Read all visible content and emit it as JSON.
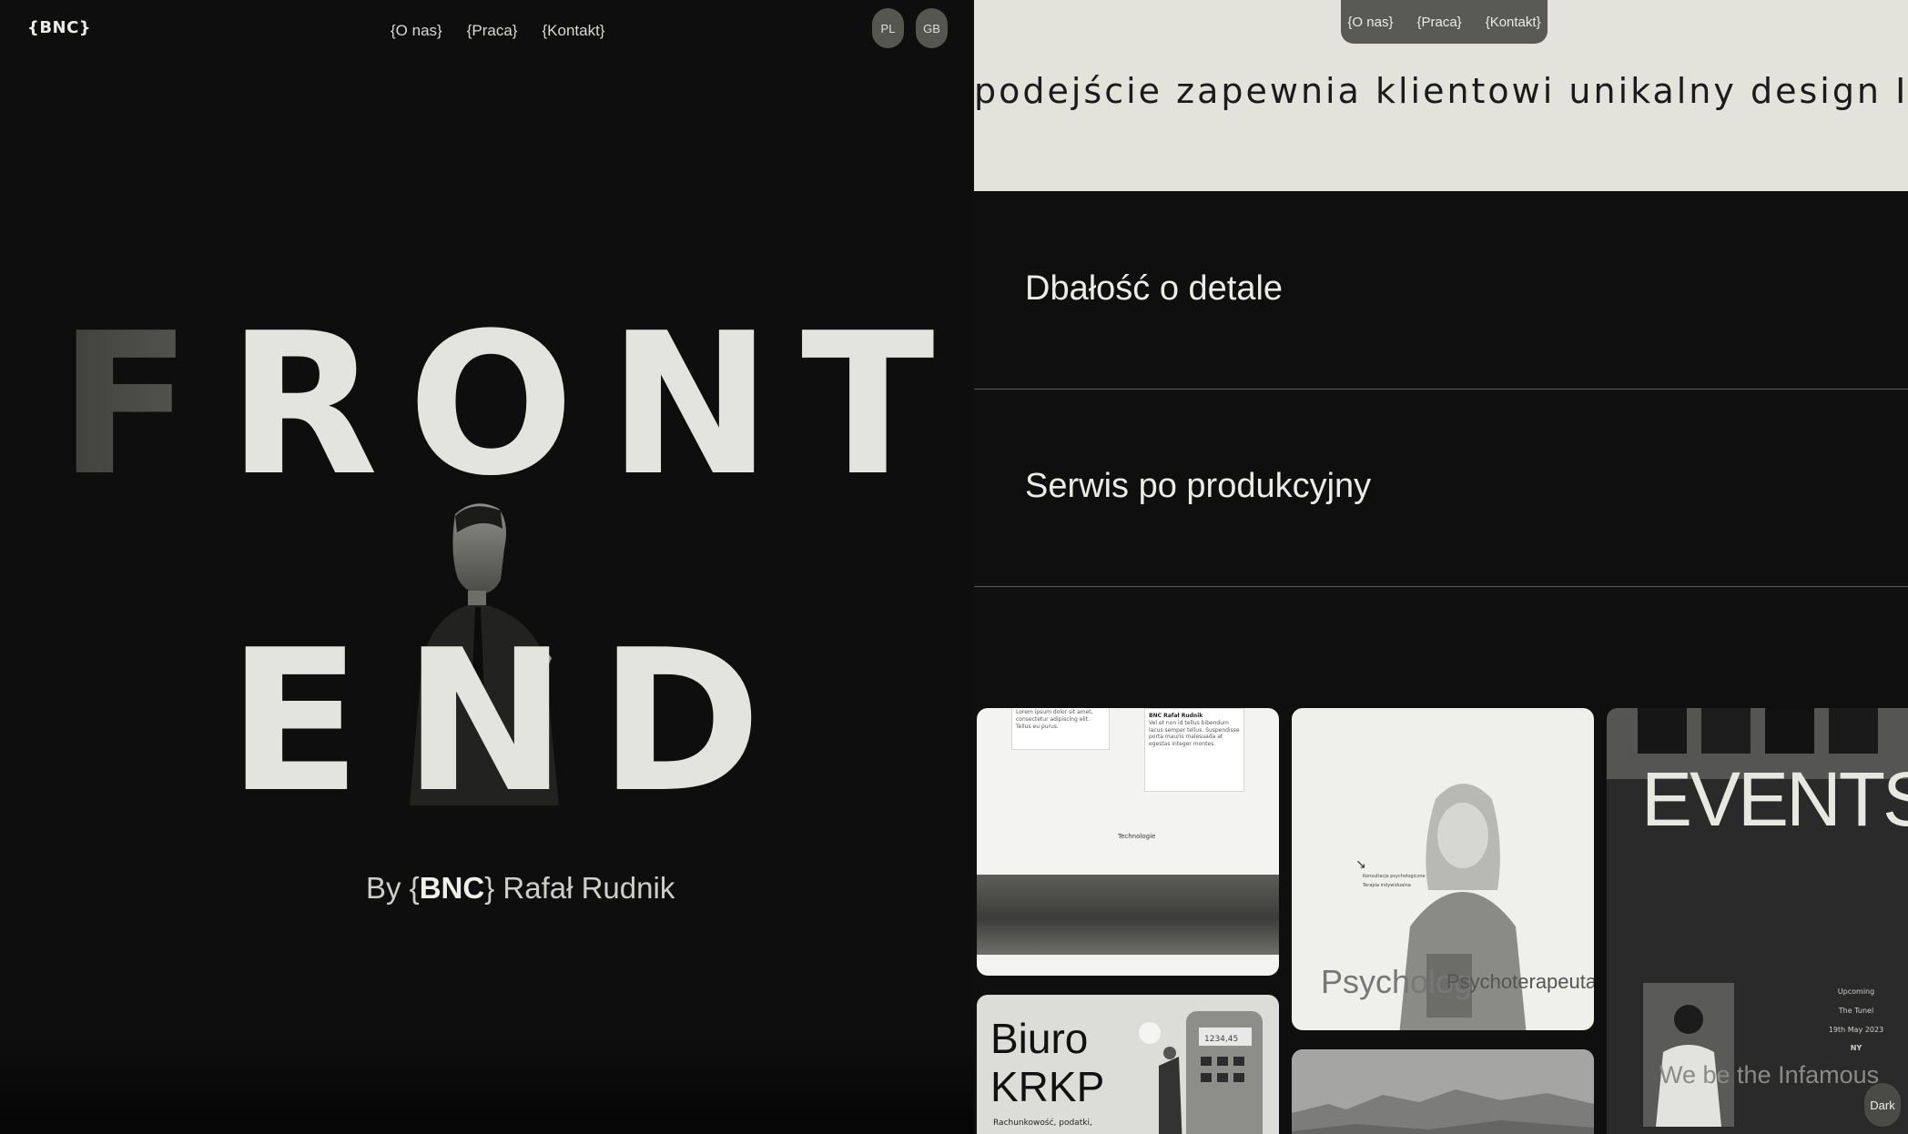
{
  "left": {
    "logo": "{BNC}",
    "nav": [
      "{O nas}",
      "{Praca}",
      "{Kontakt}"
    ],
    "lang": [
      "PL",
      "GB"
    ],
    "hero_line1": [
      "F",
      "R",
      "O",
      "N",
      "T"
    ],
    "hero_line2": [
      "E",
      "N",
      "D"
    ],
    "byline_prefix": "By {",
    "byline_brand": "BNC",
    "byline_suffix": "} Rafał Rudnik"
  },
  "right": {
    "nav": [
      "{O nas}",
      "{Praca}",
      "{Kontakt}"
    ],
    "marquee": "podejście zapewnia klientowi unikalny design   Indywidu",
    "services": [
      "Dbałość o detale",
      "Serwis po produkcyjny"
    ],
    "cards": {
      "c1_title": "BNC Rafał Rudnik",
      "c1_tech": "Technologie",
      "biuro_line1": "Biuro",
      "biuro_line2": "KRKP",
      "biuro_sub": "Rachunkowość, podatki,",
      "calc_display": "1234,45",
      "psy_big": "Psycholog",
      "psy_small": "Psychoterapeuta",
      "psy_list": [
        "Konsultacje psychologiczne",
        "Terapia indywidualna"
      ],
      "events": "EVENTS",
      "upcoming": [
        "Upcoming",
        "The Tunel",
        "19th May 2023",
        "NY"
      ],
      "infamous": "We be the Infamous"
    },
    "dark_button": "Dark"
  },
  "colors": {
    "bg": "#0e0e0e",
    "band": "#e3e3dc",
    "text_light": "#e4e4de",
    "pill": "#5a5a55"
  }
}
